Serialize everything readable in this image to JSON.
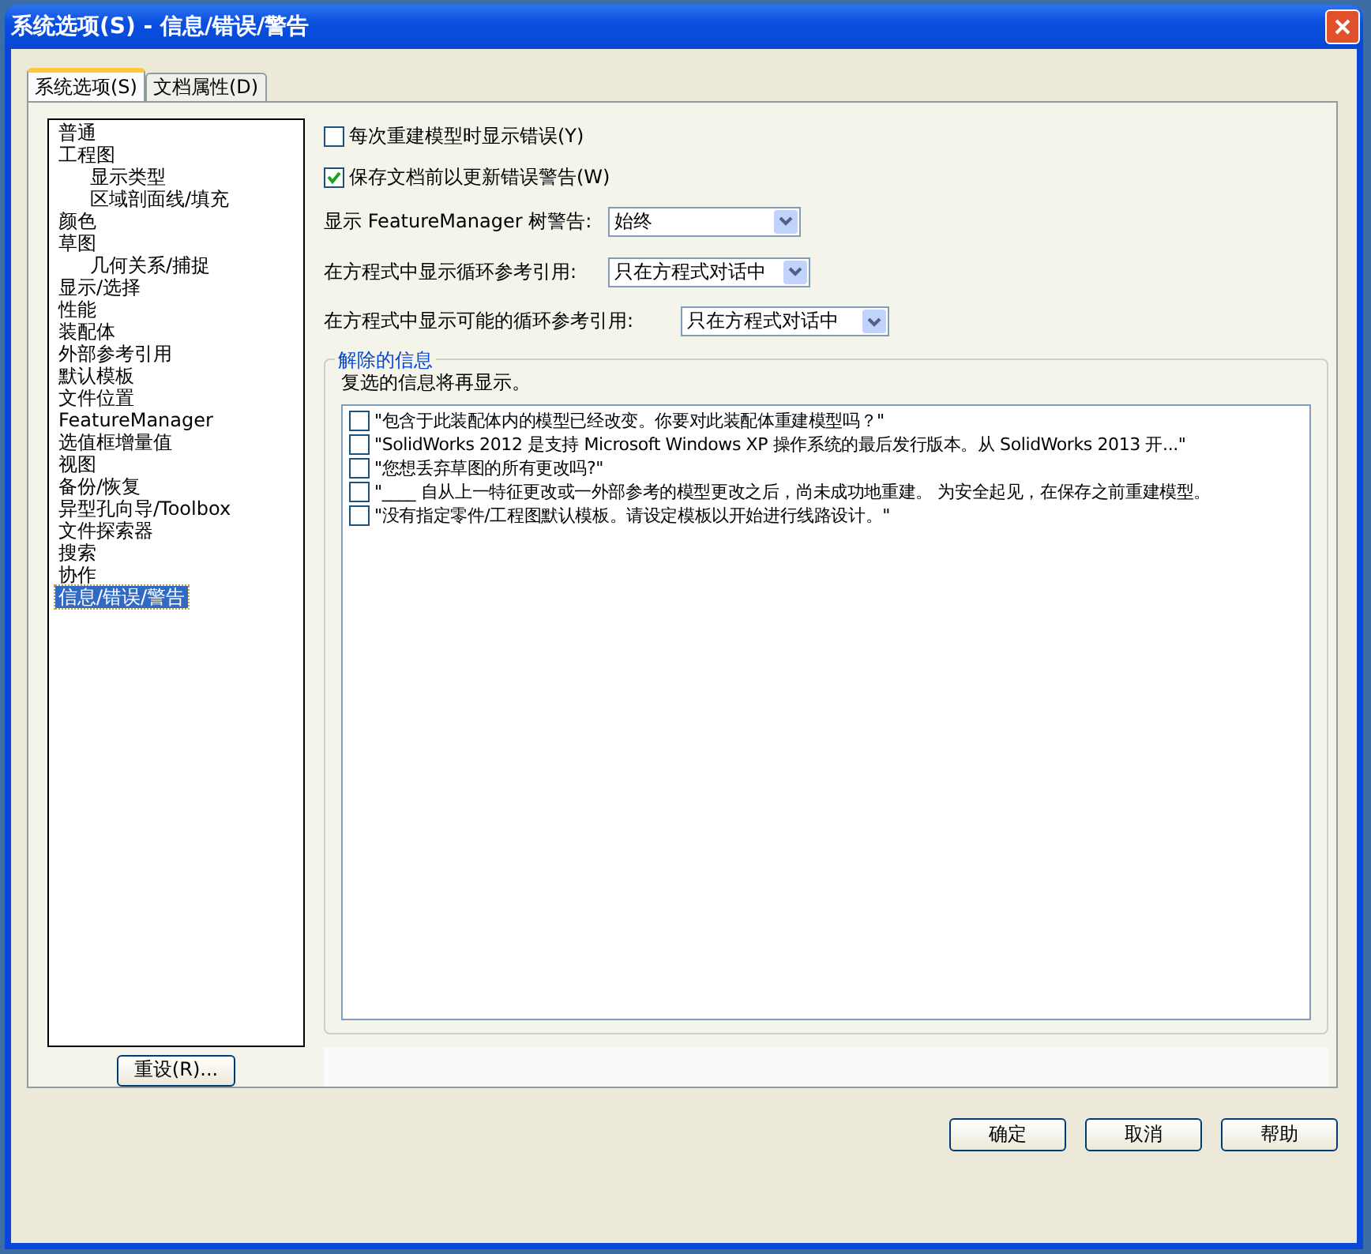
{
  "window": {
    "title": "系统选项(S) - 信息/错误/警告"
  },
  "tabs": [
    {
      "label": "系统选项(S)",
      "selected": true
    },
    {
      "label": "文档属性(D)",
      "selected": false
    }
  ],
  "tree": [
    {
      "label": "普通",
      "selected": false
    },
    {
      "label": "工程图",
      "selected": false,
      "children": [
        {
          "label": "显示类型",
          "selected": false
        },
        {
          "label": "区域剖面线/填充",
          "selected": false
        }
      ]
    },
    {
      "label": "颜色",
      "selected": false
    },
    {
      "label": "草图",
      "selected": false,
      "children": [
        {
          "label": "几何关系/捕捉",
          "selected": false
        }
      ]
    },
    {
      "label": "显示/选择",
      "selected": false
    },
    {
      "label": "性能",
      "selected": false
    },
    {
      "label": "装配体",
      "selected": false
    },
    {
      "label": "外部参考引用",
      "selected": false
    },
    {
      "label": "默认模板",
      "selected": false
    },
    {
      "label": "文件位置",
      "selected": false
    },
    {
      "label": "FeatureManager",
      "selected": false
    },
    {
      "label": "选值框增量值",
      "selected": false
    },
    {
      "label": "视图",
      "selected": false
    },
    {
      "label": "备份/恢复",
      "selected": false
    },
    {
      "label": "异型孔向导/Toolbox",
      "selected": false
    },
    {
      "label": "文件探索器",
      "selected": false
    },
    {
      "label": "搜索",
      "selected": false
    },
    {
      "label": "协作",
      "selected": false
    },
    {
      "label": "信息/错误/警告",
      "selected": true
    }
  ],
  "reset_button": "重设(R)...",
  "options": [
    {
      "label": "每次重建模型时显示错误(Y)",
      "checked": false
    },
    {
      "label": "保存文档前以更新错误警告(W)",
      "checked": true
    }
  ],
  "dropdowns": [
    {
      "label": "显示 FeatureManager 树警告:",
      "value": "始终"
    },
    {
      "label": "在方程式中显示循环参考引用:",
      "value": "只在方程式对话中"
    },
    {
      "label": "在方程式中显示可能的循环参考引用:",
      "value": "只在方程式对话中"
    }
  ],
  "dismissed": {
    "title": "解除的信息",
    "hint": "复选的信息将再显示。",
    "messages": [
      {
        "text": "\"包含于此装配体内的模型已经改变。你要对此装配体重建模型吗？\"",
        "checked": false
      },
      {
        "text": "\"SolidWorks 2012 是支持 Microsoft Windows XP 操作系统的最后发行版本。从 SolidWorks 2013 开...\"",
        "checked": false
      },
      {
        "text": "\"您想丢弃草图的所有更改吗?\"",
        "checked": false
      },
      {
        "text": "\"____ 自从上一特征更改或一外部参考的模型更改之后，尚未成功地重建。 为安全起见，在保存之前重建模型。",
        "checked": false
      },
      {
        "text": "\"没有指定零件/工程图默认模板。请设定模板以开始进行线路设计。\"",
        "checked": false
      }
    ]
  },
  "buttons": [
    "确定",
    "取消",
    "帮助"
  ]
}
